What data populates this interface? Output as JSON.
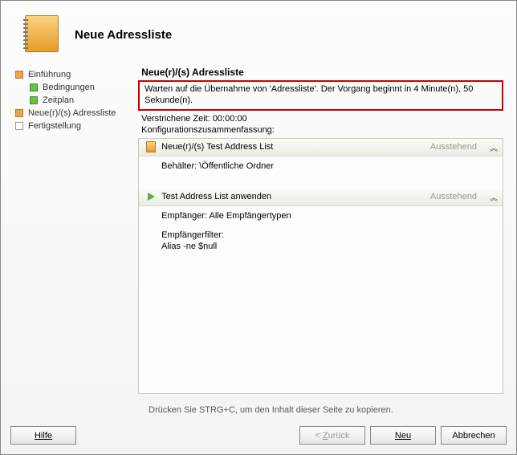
{
  "header": {
    "title": "Neue Adressliste"
  },
  "sidebar": {
    "items": [
      {
        "label": "Einführung",
        "style": "orange"
      },
      {
        "label": "Bedingungen",
        "style": "green"
      },
      {
        "label": "Zeitplan",
        "style": "green"
      },
      {
        "label": "Neue(r)/(s) Adressliste",
        "style": "orange"
      },
      {
        "label": "Fertigstellung",
        "style": "plain"
      }
    ]
  },
  "main": {
    "title": "Neue(r)/(s) Adressliste",
    "wait_message": "Warten auf die Übernahme von 'Adressliste'. Der Vorgang beginnt in 4 Minute(n), 50 Sekunde(n).",
    "elapsed_label": "Verstrichene Zeit:",
    "elapsed_value": "00:00:00",
    "summary_label": "Konfigurationszusammenfassung:",
    "groups": [
      {
        "title": "Neue(r)/(s) Test Address List",
        "status": "Ausstehend",
        "body": {
          "container_label": "Behälter:",
          "container_value": "\\Öffentliche Ordner"
        }
      },
      {
        "title": "Test Address List anwenden",
        "status": "Ausstehend",
        "body": {
          "recipients_label": "Empfänger:",
          "recipients_value": "Alle Empfängertypen",
          "filter_label": "Empfängerfilter:",
          "filter_value": "Alias -ne $null"
        }
      }
    ],
    "copy_hint": "Drücken Sie STRG+C, um den Inhalt dieser Seite zu kopieren."
  },
  "footer": {
    "help": "Hilfe",
    "back": "< Zurück",
    "next": "Neu",
    "cancel": "Abbrechen"
  }
}
